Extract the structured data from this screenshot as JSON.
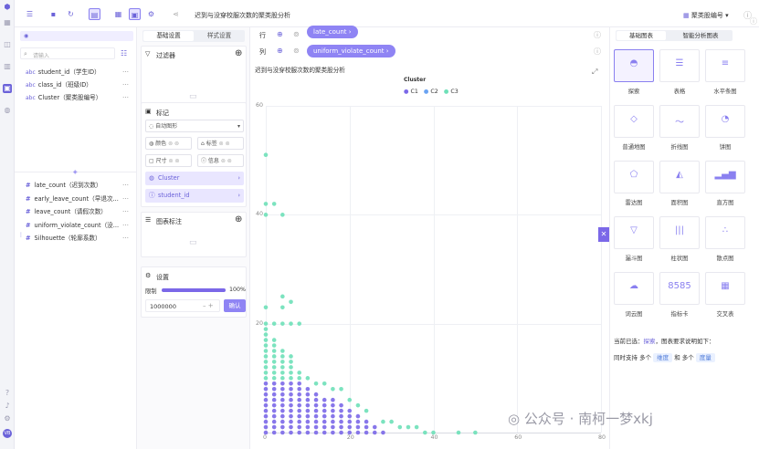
{
  "toolbar": {
    "title": "迟到与没穿校服次数的聚类股分析",
    "dataset": "聚类股编号"
  },
  "left": {
    "search_placeholder": "请输入",
    "top_fields": [
      {
        "label": "student_id（学生ID）"
      },
      {
        "label": "class_id（班级ID）"
      },
      {
        "label": "Cluster（聚类股编号）"
      }
    ],
    "measures": [
      {
        "label": "late_count（迟到次数）"
      },
      {
        "label": "early_leave_count（早退次..."
      },
      {
        "label": "leave_count（请假次数）"
      },
      {
        "label": "uniform_violate_count（没..."
      },
      {
        "label": "Silhouette（轮廓系数）"
      }
    ]
  },
  "config": {
    "tabs": [
      "基础设置",
      "样式设置"
    ],
    "filter": "过滤器",
    "marks": "标记",
    "auto_draw": "自动图形",
    "enc_chips": [
      "颜色",
      "标签",
      "尺寸",
      "信息"
    ],
    "tags": [
      "Cluster",
      "student_id"
    ],
    "annot": "图表标注",
    "settings": "设置",
    "limit_label": "限制",
    "limit_pct": "100%",
    "limit_value": "1000000",
    "confirm": "确认",
    "limit_fraction": 1.0
  },
  "shelves": {
    "row_label": "行",
    "row_field": "late_count",
    "col_label": "列",
    "col_field": "uniform_violate_count"
  },
  "right": {
    "tabs": [
      "基础图表",
      "智能分析图表"
    ],
    "tiles": [
      "探索",
      "表格",
      "水平条图",
      "普通地图",
      "折线图",
      "饼图",
      "雷达图",
      "面积图",
      "直方图",
      "漏斗图",
      "柱状图",
      "散点图",
      "词云图",
      "指标卡",
      "交叉表"
    ],
    "footer1": "当前已选：",
    "footer1_sel": "探索",
    "footer1_tail": "，图表要求说明如下：",
    "footer2a": "同时支持 多个",
    "footer2b": "维度",
    "footer2c": "和 多个",
    "footer2d": "度量"
  },
  "watermark": "公众号 · 南柯一梦xkj",
  "chart_data": {
    "type": "scatter",
    "title": "迟到与没穿校服次数的聚类股分析",
    "legend_title": "Cluster",
    "legend": [
      {
        "name": "C1",
        "color": "#7b68e8"
      },
      {
        "name": "C2",
        "color": "#6aa3f2"
      },
      {
        "name": "C3",
        "color": "#6ee0b8"
      }
    ],
    "xlim": [
      0,
      80
    ],
    "ylim": [
      0,
      60
    ],
    "xticks": [
      0,
      20,
      40,
      60,
      80
    ],
    "yticks": [
      20,
      40,
      60
    ],
    "series": [
      {
        "name": "C3",
        "color": "#6ee0b8",
        "points": [
          [
            0,
            51
          ],
          [
            0,
            42
          ],
          [
            0,
            40
          ],
          [
            2,
            42
          ],
          [
            4,
            40
          ],
          [
            4,
            25
          ],
          [
            4,
            23
          ],
          [
            6,
            24
          ],
          [
            0,
            23
          ],
          [
            0,
            20
          ],
          [
            2,
            20
          ],
          [
            4,
            20
          ],
          [
            6,
            20
          ],
          [
            8,
            20
          ],
          [
            0,
            19
          ],
          [
            0,
            18
          ],
          [
            0,
            17
          ],
          [
            2,
            17
          ],
          [
            0,
            16
          ],
          [
            2,
            16
          ],
          [
            0,
            15
          ],
          [
            2,
            15
          ],
          [
            4,
            15
          ],
          [
            0,
            14
          ],
          [
            2,
            14
          ],
          [
            4,
            14
          ],
          [
            6,
            14
          ],
          [
            0,
            13
          ],
          [
            2,
            13
          ],
          [
            4,
            13
          ],
          [
            6,
            13
          ],
          [
            0,
            12
          ],
          [
            2,
            12
          ],
          [
            4,
            12
          ],
          [
            6,
            12
          ],
          [
            0,
            11
          ],
          [
            2,
            11
          ],
          [
            4,
            11
          ],
          [
            6,
            11
          ],
          [
            8,
            11
          ],
          [
            0,
            10
          ],
          [
            2,
            10
          ],
          [
            4,
            10
          ],
          [
            6,
            10
          ],
          [
            8,
            10
          ],
          [
            10,
            10
          ],
          [
            12,
            9
          ],
          [
            14,
            9
          ],
          [
            16,
            8
          ],
          [
            18,
            8
          ],
          [
            20,
            6
          ],
          [
            22,
            5
          ],
          [
            24,
            4
          ],
          [
            28,
            2
          ],
          [
            30,
            2
          ],
          [
            32,
            1
          ],
          [
            34,
            1
          ],
          [
            36,
            1
          ],
          [
            38,
            0
          ],
          [
            40,
            0
          ],
          [
            46,
            0
          ],
          [
            50,
            0
          ]
        ]
      },
      {
        "name": "C1",
        "color": "#7b68e8",
        "points": [
          [
            0,
            9
          ],
          [
            2,
            9
          ],
          [
            4,
            9
          ],
          [
            6,
            9
          ],
          [
            8,
            9
          ],
          [
            0,
            8
          ],
          [
            2,
            8
          ],
          [
            4,
            8
          ],
          [
            6,
            8
          ],
          [
            8,
            8
          ],
          [
            10,
            8
          ],
          [
            0,
            7
          ],
          [
            2,
            7
          ],
          [
            4,
            7
          ],
          [
            6,
            7
          ],
          [
            8,
            7
          ],
          [
            10,
            7
          ],
          [
            12,
            7
          ],
          [
            0,
            6
          ],
          [
            2,
            6
          ],
          [
            4,
            6
          ],
          [
            6,
            6
          ],
          [
            8,
            6
          ],
          [
            10,
            6
          ],
          [
            12,
            6
          ],
          [
            14,
            6
          ],
          [
            16,
            6
          ],
          [
            0,
            5
          ],
          [
            2,
            5
          ],
          [
            4,
            5
          ],
          [
            6,
            5
          ],
          [
            8,
            5
          ],
          [
            10,
            5
          ],
          [
            12,
            5
          ],
          [
            14,
            5
          ],
          [
            16,
            5
          ],
          [
            18,
            5
          ],
          [
            0,
            4
          ],
          [
            2,
            4
          ],
          [
            4,
            4
          ],
          [
            6,
            4
          ],
          [
            8,
            4
          ],
          [
            10,
            4
          ],
          [
            12,
            4
          ],
          [
            14,
            4
          ],
          [
            16,
            4
          ],
          [
            18,
            4
          ],
          [
            20,
            4
          ],
          [
            0,
            3
          ],
          [
            2,
            3
          ],
          [
            4,
            3
          ],
          [
            6,
            3
          ],
          [
            8,
            3
          ],
          [
            10,
            3
          ],
          [
            12,
            3
          ],
          [
            14,
            3
          ],
          [
            16,
            3
          ],
          [
            18,
            3
          ],
          [
            20,
            3
          ],
          [
            22,
            3
          ],
          [
            0,
            2
          ],
          [
            2,
            2
          ],
          [
            4,
            2
          ],
          [
            6,
            2
          ],
          [
            8,
            2
          ],
          [
            10,
            2
          ],
          [
            12,
            2
          ],
          [
            14,
            2
          ],
          [
            16,
            2
          ],
          [
            18,
            2
          ],
          [
            20,
            2
          ],
          [
            22,
            2
          ],
          [
            24,
            2
          ],
          [
            0,
            1
          ],
          [
            2,
            1
          ],
          [
            4,
            1
          ],
          [
            6,
            1
          ],
          [
            8,
            1
          ],
          [
            10,
            1
          ],
          [
            12,
            1
          ],
          [
            14,
            1
          ],
          [
            16,
            1
          ],
          [
            18,
            1
          ],
          [
            20,
            1
          ],
          [
            22,
            1
          ],
          [
            24,
            1
          ],
          [
            26,
            1
          ],
          [
            0,
            0
          ],
          [
            2,
            0
          ],
          [
            4,
            0
          ],
          [
            6,
            0
          ],
          [
            8,
            0
          ],
          [
            10,
            0
          ],
          [
            12,
            0
          ],
          [
            14,
            0
          ],
          [
            16,
            0
          ],
          [
            18,
            0
          ],
          [
            20,
            0
          ],
          [
            22,
            0
          ],
          [
            24,
            0
          ],
          [
            26,
            0
          ],
          [
            28,
            0
          ]
        ]
      }
    ]
  }
}
